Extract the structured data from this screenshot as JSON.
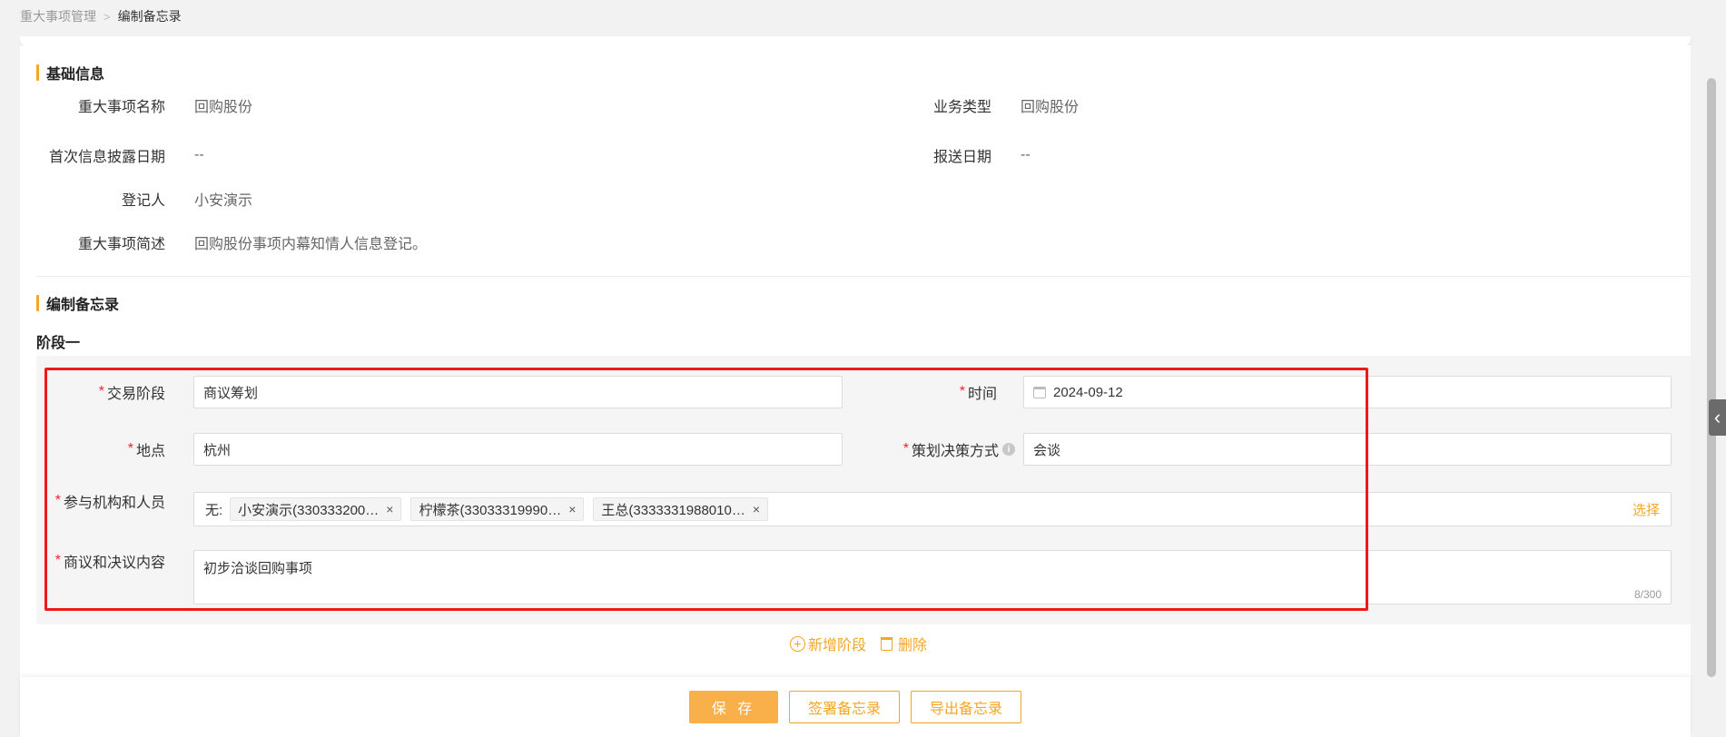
{
  "breadcrumb": {
    "parent": "重大事项管理",
    "separator": ">",
    "current": "编制备忘录"
  },
  "basic_info": {
    "title": "基础信息",
    "fields": {
      "matter_name": {
        "label": "重大事项名称",
        "value": "回购股份"
      },
      "business_type": {
        "label": "业务类型",
        "value": "回购股份"
      },
      "first_disclosure_date": {
        "label": "首次信息披露日期",
        "value": "--"
      },
      "report_date": {
        "label": "报送日期",
        "value": "--"
      },
      "registrant": {
        "label": "登记人",
        "value": "小安演示"
      },
      "description": {
        "label": "重大事项简述",
        "value": "回购股份事项内幕知情人信息登记。"
      }
    }
  },
  "memo": {
    "title": "编制备忘录",
    "stage": {
      "title": "阶段一",
      "trade_stage": {
        "label": "交易阶段",
        "value": "商议筹划"
      },
      "time": {
        "label": "时间",
        "value": "2024-09-12"
      },
      "location": {
        "label": "地点",
        "value": "杭州"
      },
      "decision_method": {
        "label": "策划决策方式",
        "value": "会谈"
      },
      "participants": {
        "label": "参与机构和人员",
        "prefix": "无:",
        "tags": [
          "小安演示(330333200…",
          "柠檬茶(33033319990…",
          "王总(3333331988010…"
        ],
        "choose_label": "选择"
      },
      "content": {
        "label": "商议和决议内容",
        "value": "初步洽谈回购事项",
        "counter": "8/300"
      }
    },
    "add_stage_label": "新增阶段",
    "delete_label": "删除"
  },
  "footer": {
    "save_label": "保 存",
    "sign_label": "签署备忘录",
    "export_label": "导出备忘录"
  },
  "colors": {
    "accent": "#f5a623",
    "required": "#f5222d",
    "highlight_box": "#f01818"
  },
  "required_mark": "*",
  "tag_close": "×",
  "info_glyph": "i",
  "plus_glyph": "+",
  "handle_glyph": "‹"
}
